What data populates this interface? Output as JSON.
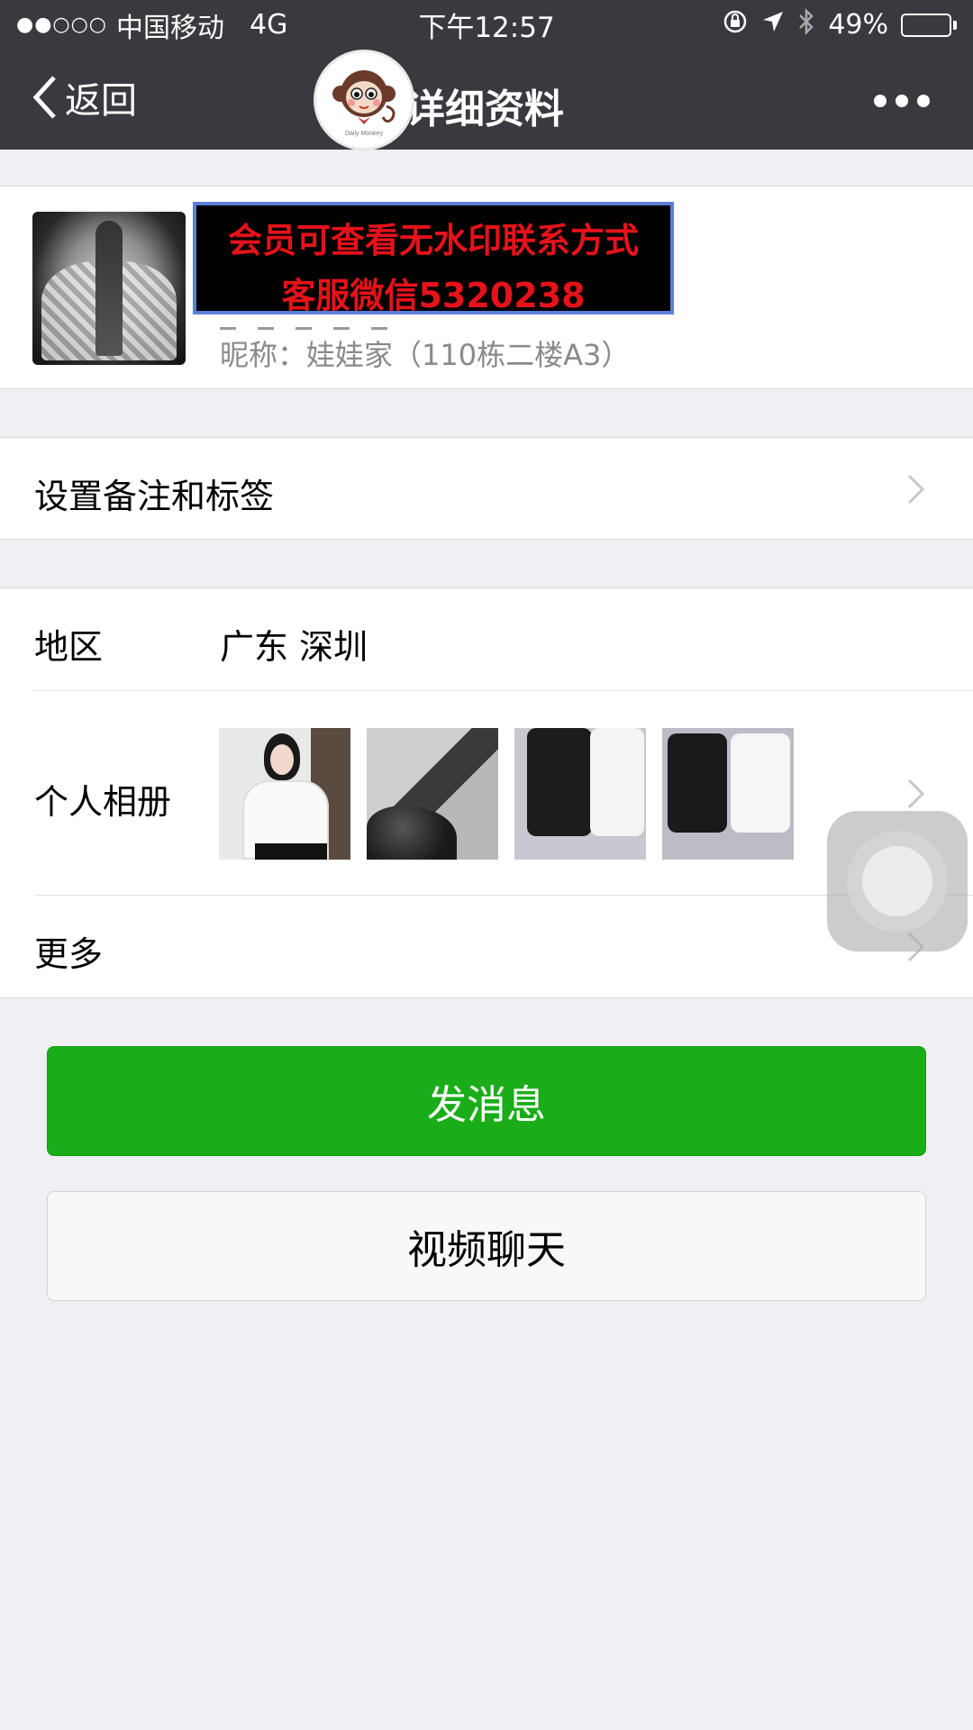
{
  "status_bar": {
    "signal_dots": "●●○○○",
    "carrier": "中国移动",
    "network": "4G",
    "time": "下午12:57",
    "battery_percent": "49%",
    "battery_level": 0.49
  },
  "nav": {
    "back_label": "返回",
    "title": "详细资料",
    "logo_text": "Daily Monkey"
  },
  "profile": {
    "watermark_line1": "会员可查看无水印联系方式",
    "watermark_line2": "客服微信5320238",
    "nickname": "昵称：娃娃家（110栋二楼A3）"
  },
  "remark_row": {
    "label": "设置备注和标签"
  },
  "info": {
    "region_label": "地区",
    "region_value": "广东 深圳",
    "album_label": "个人相册",
    "more_label": "更多"
  },
  "buttons": {
    "send_message": "发消息",
    "video_chat": "视频聊天"
  },
  "colors": {
    "nav_bg": "#393a3f",
    "primary_green": "#1aad19",
    "page_bg": "#efeff4",
    "watermark_text": "#e5121a"
  }
}
